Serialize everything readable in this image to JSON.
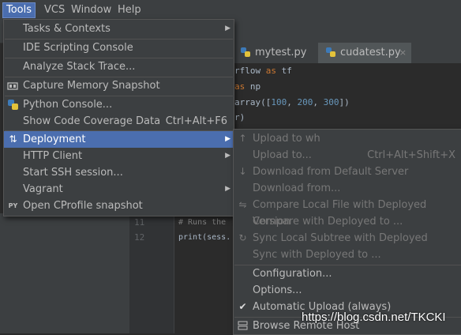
{
  "menubar": {
    "items": [
      "Tools",
      "VCS",
      "Window",
      "Help"
    ]
  },
  "tabs": [
    {
      "label": "mytest.py",
      "close": "×"
    },
    {
      "label": "cudatest.py",
      "close": "×"
    }
  ],
  "editor": {
    "lines": [
      "rflow",
      " as ",
      "tf",
      "as",
      " np",
      "array([",
      "100",
      ", ",
      "200",
      ", ",
      "300",
      "])",
      "r)"
    ]
  },
  "lower_editor": {
    "line_numbers": [
      "11",
      "12"
    ],
    "lines": [
      "# Runs the",
      "print(sess."
    ]
  },
  "tools_menu": {
    "items": [
      {
        "label": "Tasks & Contexts"
      },
      {
        "label": "IDE Scripting Console"
      },
      {
        "label": "Analyze Stack Trace..."
      },
      {
        "label": "Capture Memory Snapshot"
      },
      {
        "label": "Python Console..."
      },
      {
        "label": "Show Code Coverage Data",
        "shortcut": "Ctrl+Alt+F6"
      },
      {
        "label": "Deployment"
      },
      {
        "label": "HTTP Client"
      },
      {
        "label": "Start SSH session..."
      },
      {
        "label": "Vagrant"
      },
      {
        "label": "Open CProfile snapshot",
        "icon_text": "PY"
      }
    ]
  },
  "deployment_menu": {
    "items": [
      {
        "label": "Upload to wh"
      },
      {
        "label": "Upload to...",
        "shortcut": "Ctrl+Alt+Shift+X"
      },
      {
        "label": "Download from Default Server"
      },
      {
        "label": "Download from..."
      },
      {
        "label": "Compare Local File with Deployed Version"
      },
      {
        "label": "Compare with Deployed to ..."
      },
      {
        "label": "Sync Local Subtree with Deployed"
      },
      {
        "label": "Sync with Deployed to ..."
      },
      {
        "label": "Configuration..."
      },
      {
        "label": "Options..."
      },
      {
        "label": "Automatic Upload (always)"
      },
      {
        "label": "Browse Remote Host"
      }
    ]
  },
  "watermark": "https://blog.csdn.net/TKCKI"
}
